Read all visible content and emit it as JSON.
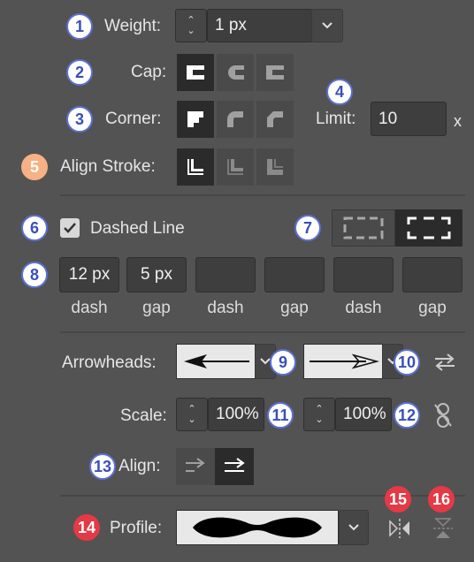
{
  "weight": {
    "label": "Weight:",
    "value": "1 px",
    "badge": "1"
  },
  "cap": {
    "label": "Cap:",
    "badge": "2"
  },
  "corner": {
    "label": "Corner:",
    "badge": "3"
  },
  "limit": {
    "label": "Limit:",
    "value": "10",
    "suffix": "x",
    "badge": "4"
  },
  "align_stroke": {
    "label": "Align Stroke:",
    "badge": "5"
  },
  "dashed": {
    "label": "Dashed Line",
    "checked": true,
    "badge": "6",
    "style_badge": "7"
  },
  "dash_fields": {
    "badge": "8",
    "items": [
      {
        "value": "12 px",
        "label": "dash"
      },
      {
        "value": "5 px",
        "label": "gap"
      },
      {
        "value": "",
        "label": "dash"
      },
      {
        "value": "",
        "label": "gap"
      },
      {
        "value": "",
        "label": "dash"
      },
      {
        "value": "",
        "label": "gap"
      }
    ]
  },
  "arrowheads": {
    "label": "Arrowheads:",
    "start_badge": "9",
    "end_badge": "10"
  },
  "scale": {
    "label": "Scale:",
    "start_value": "100%",
    "end_value": "100%",
    "start_badge": "11",
    "end_badge": "12"
  },
  "align": {
    "label": "Align:",
    "badge": "13"
  },
  "profile": {
    "label": "Profile:",
    "badge": "14",
    "flip_h_badge": "15",
    "flip_v_badge": "16"
  },
  "colors": {
    "panel": "#535353",
    "selected": "#2b2b2b",
    "badge_border": "#5b6fd6",
    "badge_red": "#e63946",
    "badge_peach": "#f6b184"
  }
}
